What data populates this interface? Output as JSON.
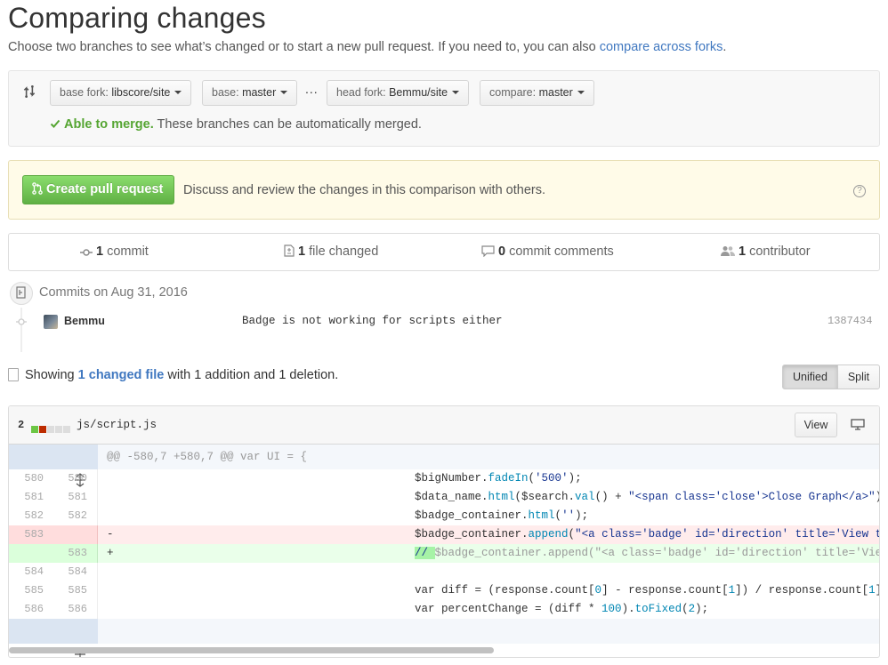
{
  "header": {
    "title": "Comparing changes",
    "subtitle_text": "Choose two branches to see what’s changed or to start a new pull request. If you need to, you can also ",
    "subtitle_link": "compare across forks",
    "subtitle_end": "."
  },
  "range": {
    "base_fork_label": "base fork: ",
    "base_fork_value": "libscore/site",
    "base_label": "base: ",
    "base_value": "master",
    "dots": "...",
    "head_fork_label": "head fork: ",
    "head_fork_value": "Bemmu/site",
    "compare_label": "compare: ",
    "compare_value": "master",
    "merge_ok": "Able to merge.",
    "merge_text": " These branches can be automatically merged."
  },
  "pull_request": {
    "button_label": "Create pull request",
    "description": "Discuss and review the changes in this comparison with others.",
    "help": "?"
  },
  "numbers": {
    "commits_count": "1",
    "commits_label": " commit",
    "files_count": "1",
    "files_label": " file changed",
    "comments_count": "0",
    "comments_label": " commit comments",
    "contributors_count": "1",
    "contributors_label": " contributor"
  },
  "commits": {
    "heading": "Commits on Aug 31, 2016",
    "items": [
      {
        "author": "Bemmu",
        "message": "Badge is not working for scripts either",
        "sha": "1387434"
      }
    ]
  },
  "summary": {
    "prefix": "Showing ",
    "link": "1 changed file",
    "suffix": " with 1 addition and 1 deletion.",
    "unified_label": "Unified",
    "split_label": "Split"
  },
  "file": {
    "diff_count": "2",
    "name": "js/script.js",
    "view_label": "View",
    "hunk_header": "@@ -580,7 +580,7 @@ var UI = {",
    "lines": [
      {
        "old": "580",
        "new": "580",
        "sign": "",
        "type": "ctx"
      },
      {
        "old": "581",
        "new": "581",
        "sign": "",
        "type": "ctx"
      },
      {
        "old": "582",
        "new": "582",
        "sign": "",
        "type": "ctx"
      },
      {
        "old": "583",
        "new": "",
        "sign": "-",
        "type": "del"
      },
      {
        "old": "",
        "new": "583",
        "sign": "+",
        "type": "add"
      },
      {
        "old": "584",
        "new": "584",
        "sign": "",
        "type": "ctx"
      },
      {
        "old": "585",
        "new": "585",
        "sign": "",
        "type": "ctx"
      },
      {
        "old": "586",
        "new": "586",
        "sign": "",
        "type": "ctx"
      }
    ],
    "code": {
      "l1_a": "$bigNumber.",
      "l1_b": "fadeIn",
      "l1_c": "(",
      "l1_d": "'500'",
      "l1_e": ");",
      "l2_a": "$data_name.",
      "l2_b": "html",
      "l2_c": "($search.",
      "l2_d": "val",
      "l2_e": "() + ",
      "l2_f": "\"<span class='close'>Close Graph</a>\"",
      "l2_g": ");",
      "l3_a": "$badge_container.",
      "l3_b": "html",
      "l3_c": "(",
      "l3_d": "''",
      "l3_e": ");",
      "l4_a": "$badge_container.",
      "l4_b": "append",
      "l4_c": "(",
      "l4_d": "\"<a class='badge' id='direction' title='View the",
      "l5_a": "// ",
      "l5_b": "$badge_container.append(\"<a class='badge' id='direction' title='View t",
      "l7_a": "var",
      "l7_b": " diff = (response.count[",
      "l7_c": "0",
      "l7_d": "] - response.count[",
      "l7_e": "1",
      "l7_f": "]) / response.count[",
      "l7_g": "1",
      "l7_h": "];",
      "l8_a": "var",
      "l8_b": " percentChange = (diff * ",
      "l8_c": "100",
      "l8_d": ").",
      "l8_e": "toFixed",
      "l8_f": "(",
      "l8_g": "2",
      "l8_h": ");"
    }
  },
  "colors": {
    "link": "#4078c0",
    "merge_ok": "#55a532",
    "pr_button": "#60b044",
    "deletion": "#ffecec",
    "addition": "#eaffea"
  }
}
